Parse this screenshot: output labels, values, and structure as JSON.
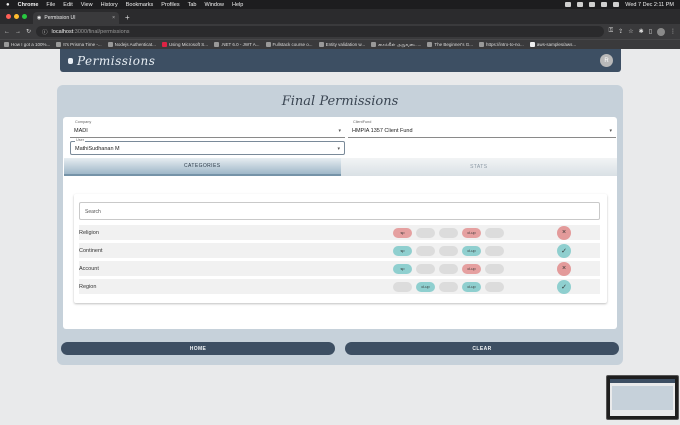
{
  "macos": {
    "app": "Chrome",
    "menus": [
      "File",
      "Edit",
      "View",
      "History",
      "Bookmarks",
      "Profiles",
      "Tab",
      "Window",
      "Help"
    ],
    "clock": "Wed 7 Dec  2:11 PM"
  },
  "browser": {
    "tab_title": "Permission UI",
    "url_host": "localhost",
    "url_path": ":3000/final/permissions",
    "bookmarks": [
      "How I got a 100%...",
      "It's Prisma Time -...",
      "Nodejs Authenticat...",
      "Using Microsoft S...",
      ".NET 6.0 - JWT A...",
      "Fullstack course o...",
      "Entity validation w...",
      "சைக்கிள் அறுவடை...",
      "The Beginner's G...",
      "https://intro-to-no...",
      "aws-samples/aws..."
    ]
  },
  "appbar": {
    "brand": "Permissions",
    "avatar_initial": "R"
  },
  "page": {
    "title": "Final Permissions",
    "company": {
      "label": "Company",
      "value": "MADI"
    },
    "client_fund": {
      "label": "ClientFund",
      "value": "HMPIA 1357 Client Fund"
    },
    "user": {
      "label": "User",
      "value": "MathiSudhanan M"
    },
    "tabs": [
      "CATEGORIES",
      "STATS"
    ],
    "search_placeholder": "Search",
    "rows": [
      {
        "name": "Religion",
        "pills": [
          "sp",
          "",
          "",
          "cl-up",
          ""
        ],
        "pill_colors": [
          "red",
          "grey",
          "grey",
          "red",
          "grey"
        ],
        "action": "×",
        "action_color": "red"
      },
      {
        "name": "Continent",
        "pills": [
          "sp",
          "",
          "",
          "cl-up",
          ""
        ],
        "pill_colors": [
          "teal",
          "grey",
          "grey",
          "teal",
          "grey"
        ],
        "action": "✓",
        "action_color": "teal"
      },
      {
        "name": "Account",
        "pills": [
          "sp",
          "",
          "",
          "cl-up",
          ""
        ],
        "pill_colors": [
          "teal",
          "grey",
          "grey",
          "red",
          "grey"
        ],
        "action": "×",
        "action_color": "red"
      },
      {
        "name": "Region",
        "pills": [
          "",
          "cl-up",
          "",
          "cl-up",
          ""
        ],
        "pill_colors": [
          "grey",
          "teal",
          "grey",
          "teal",
          "grey"
        ],
        "action": "✓",
        "action_color": "teal"
      }
    ],
    "home_label": "HOME",
    "clear_label": "CLEAR"
  },
  "colors": {
    "primary": "#3d4f63",
    "card": "#c6d1da",
    "red": "#e39a9a",
    "teal": "#8fcfcf"
  }
}
